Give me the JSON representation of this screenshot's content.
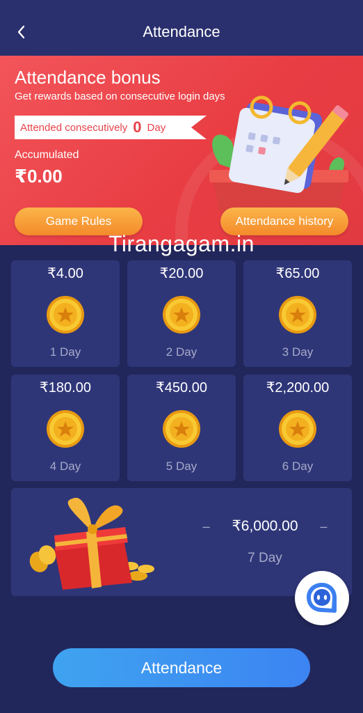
{
  "header": {
    "title": "Attendance",
    "back_icon": "chevron-left-icon"
  },
  "banner": {
    "title": "Attendance bonus",
    "subtitle": "Get rewards based on consecutive login days",
    "consecutive": {
      "prefix": "Attended consecutively",
      "count": "0",
      "suffix": "Day"
    },
    "accumulated_label": "Accumulated",
    "accumulated_value": "₹0.00",
    "game_rules_label": "Game Rules",
    "history_label": "Attendance history",
    "illustration_icon": "calendar-pencil-icon"
  },
  "watermark": "Tirangagam.in",
  "days": [
    {
      "amount": "₹4.00",
      "label": "1 Day"
    },
    {
      "amount": "₹20.00",
      "label": "2 Day"
    },
    {
      "amount": "₹65.00",
      "label": "3 Day"
    },
    {
      "amount": "₹180.00",
      "label": "4 Day"
    },
    {
      "amount": "₹450.00",
      "label": "5 Day"
    },
    {
      "amount": "₹2,200.00",
      "label": "6 Day"
    }
  ],
  "final_day": {
    "amount": "₹6,000.00",
    "label": "7 Day",
    "icon": "gift-box-icon"
  },
  "attendance_button": "Attendance",
  "colors": {
    "background": "#22275b",
    "card": "#2f3678",
    "banner_red": "#e83d43",
    "accent_orange": "#f48a2b",
    "accent_blue": "#3c84f2",
    "coin_gold": "#f6c12d"
  }
}
